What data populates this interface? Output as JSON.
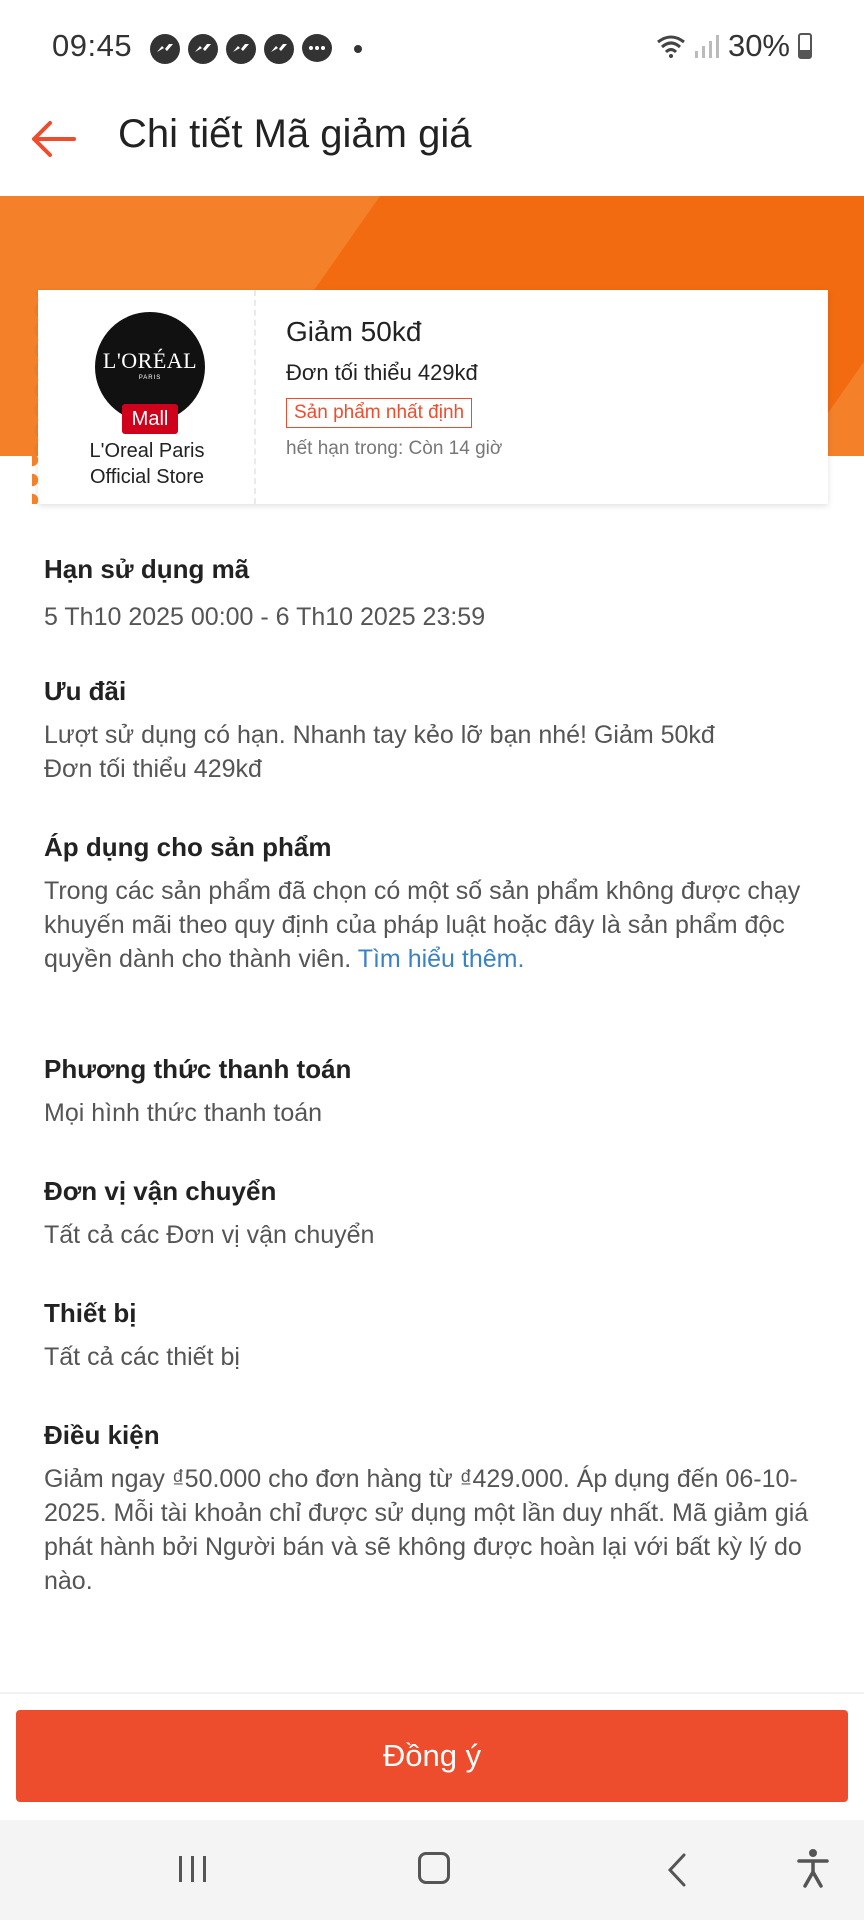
{
  "status_bar": {
    "time": "09:45",
    "battery": "30%"
  },
  "header": {
    "title": "Chi tiết Mã giảm giá"
  },
  "voucher": {
    "brand_logo_text": "L'ORÉAL",
    "brand_logo_sub": "PARIS",
    "mall_badge": "Mall",
    "store_name_line1": "L'Oreal Paris",
    "store_name_line2": "Official Store",
    "title": "Giảm 50kđ",
    "min_order": "Đơn tối thiểu 429kđ",
    "tag": "Sản phẩm nhất định",
    "expiry": "hết hạn trong: Còn 14 giờ"
  },
  "sections": {
    "validity": {
      "title": "Hạn sử dụng mã",
      "body": "5 Th10 2025 00:00 - 6 Th10 2025 23:59"
    },
    "offer": {
      "title": "Ưu đãi",
      "body_line1": "Lượt sử dụng có hạn. Nhanh tay kẻo lỡ bạn nhé! Giảm 50kđ",
      "body_line2": "Đơn tối thiểu 429kđ"
    },
    "products": {
      "title": "Áp dụng cho sản phẩm",
      "body": "Trong các sản phẩm đã chọn có một số sản phẩm không được chạy khuyến mãi theo quy định của pháp luật hoặc đây là sản phẩm độc quyền dành cho thành viên.",
      "link": "Tìm hiểu thêm."
    },
    "payment": {
      "title": "Phương thức thanh toán",
      "body": "Mọi hình thức thanh toán"
    },
    "shipping": {
      "title": "Đơn vị vận chuyển",
      "body": "Tất cả các Đơn vị vận chuyển"
    },
    "device": {
      "title": "Thiết bị",
      "body": "Tất cả các thiết bị"
    },
    "conditions": {
      "title": "Điều kiện",
      "body": "Giảm ngay ₫50.000 cho đơn hàng từ ₫429.000. Áp dụng đến 06-10-2025. Mỗi tài khoản chỉ được sử dụng một lần duy nhất. Mã giảm giá phát hành bởi Người bán và sẽ không được hoàn lại với bất kỳ lý do nào."
    }
  },
  "footer": {
    "agree_label": "Đồng ý"
  },
  "colors": {
    "primary": "#ee4d2d",
    "banner": "#f4802a",
    "banner_stripe": "#f26b10",
    "link": "#3b82c4"
  },
  "icons": {
    "back": "back-arrow-icon",
    "nav_recent": "recent-apps-icon",
    "nav_home": "home-icon",
    "nav_back": "nav-back-icon",
    "accessibility": "accessibility-icon"
  }
}
